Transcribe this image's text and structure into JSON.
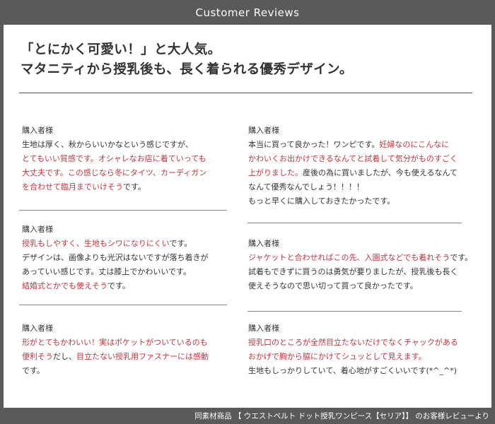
{
  "header": {
    "title": "Customer Reviews"
  },
  "headline": {
    "line1": "「とにかく可愛い！」と大人気。",
    "line2": "マタニティから授乳後も、長く着られる優秀デザイン。"
  },
  "reviews": [
    {
      "author": "購入者様",
      "lines": [
        [
          {
            "t": "生地は厚く、秋からいいかなという感じですが、",
            "red": false
          }
        ],
        [
          {
            "t": "とてもいい質感です。オシャレなお店に着ていっても",
            "red": true
          }
        ],
        [
          {
            "t": "大丈夫です。この感じなら冬にタイツ、カーディガン",
            "red": true
          }
        ],
        [
          {
            "t": "を合わせて臨月までいけそう",
            "red": true
          },
          {
            "t": "です。",
            "red": false
          }
        ]
      ]
    },
    {
      "author": "購入者様",
      "lines": [
        [
          {
            "t": "本当に買って良かった！ワンピです。",
            "red": false
          },
          {
            "t": "妊婦なのにこんなに",
            "red": true
          }
        ],
        [
          {
            "t": "かわいくお出かけできるなんてと試着して気分がものすごく",
            "red": true
          }
        ],
        [
          {
            "t": "上がりました。",
            "red": true
          },
          {
            "t": "産後の為に買いましたが、今も使えるなんて",
            "red": false
          }
        ],
        [
          {
            "t": "なんて優秀なんでしょう！！！！",
            "red": false
          }
        ],
        [
          {
            "t": "もっと早くに購入しておきたかったです。",
            "red": false
          }
        ]
      ]
    },
    {
      "author": "購入者様",
      "lines": [
        [
          {
            "t": "授乳もしやすく、生地もシワになりにくい",
            "red": true
          },
          {
            "t": "です。",
            "red": false
          }
        ],
        [
          {
            "t": "デザインは、画像よりも光沢はないですが落ち着きが",
            "red": false
          }
        ],
        [
          {
            "t": "あっていい感じです。丈は膝上でかわいいです。",
            "red": false
          }
        ],
        [
          {
            "t": "結婚式とかでも使えそう",
            "red": true
          },
          {
            "t": "です。",
            "red": false
          }
        ]
      ]
    },
    {
      "author": "購入者様",
      "lines": [
        [
          {
            "t": "ジャケットと合わせればこの先、入園式などでも着れそう",
            "red": true
          },
          {
            "t": "です。",
            "red": false
          }
        ],
        [
          {
            "t": "試着もできずに買うのは勇気が要りましたが、授乳後も長く",
            "red": false
          }
        ],
        [
          {
            "t": "使えそうなので思い切って買って良かったです。",
            "red": false
          }
        ]
      ]
    },
    {
      "author": "購入者様",
      "lines": [
        [
          {
            "t": "形がとてもかわいい！実はポケットがついているのも",
            "red": true
          }
        ],
        [
          {
            "t": "便利そう",
            "red": true
          },
          {
            "t": "だし、",
            "red": false
          },
          {
            "t": "目立たない授乳用ファスナーには感動",
            "red": true
          }
        ],
        [
          {
            "t": "です。",
            "red": false
          }
        ]
      ]
    },
    {
      "author": "購入者様",
      "lines": [
        [
          {
            "t": "授乳口のところが全然目立たないだけでなくチャックがある",
            "red": true
          }
        ],
        [
          {
            "t": "おかげで胸から脇にかけてシュッとして見えます。",
            "red": true
          }
        ],
        [
          {
            "t": "生地もしっかりしていて、着心地がすごくいいです(*^_^*)",
            "red": false
          }
        ]
      ]
    }
  ],
  "footer": {
    "text": "同素材商品 【 ウエストベルト ドット授乳ワンピース【セリア】】 のお客様レビューより"
  },
  "colors": {
    "accent_red": "#c8323a",
    "background": "#5a5a5a",
    "text": "#333333"
  }
}
